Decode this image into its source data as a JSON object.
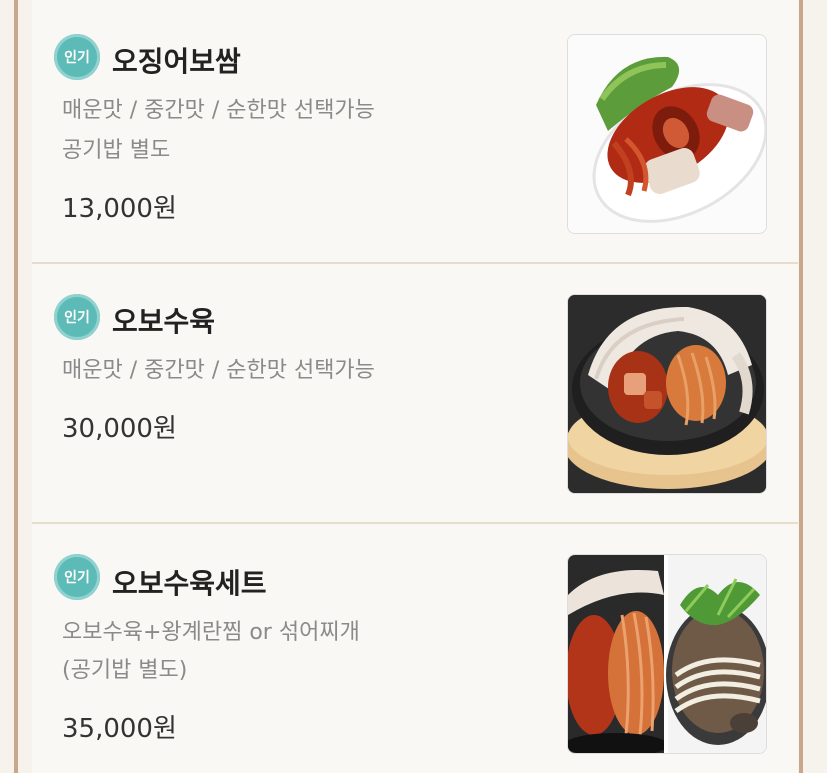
{
  "menu_items": [
    {
      "badge": "인기",
      "name": "오징어보쌈",
      "desc_lines": [
        "매운맛 / 중간맛 / 순한맛 선택가능",
        "공기밥 별도"
      ],
      "price": "13,000원",
      "photo_icon": "squid-bossam-photo"
    },
    {
      "badge": "인기",
      "name": "오보수육",
      "desc_lines": [
        "매운맛 / 중간맛 / 순한맛 선택가능"
      ],
      "price": "30,000원",
      "photo_icon": "obo-suyuk-photo"
    },
    {
      "badge": "인기",
      "name": "오보수육세트",
      "desc_lines": [
        "오보수육+왕계란찜 or 섞어찌개",
        "(공기밥 별도)"
      ],
      "price": "35,000원",
      "photo_icon": "obo-suyuk-set-photo"
    }
  ],
  "colors": {
    "badge": "#5cbab7",
    "border": "#c9a78a",
    "divider": "#e8dccb"
  }
}
